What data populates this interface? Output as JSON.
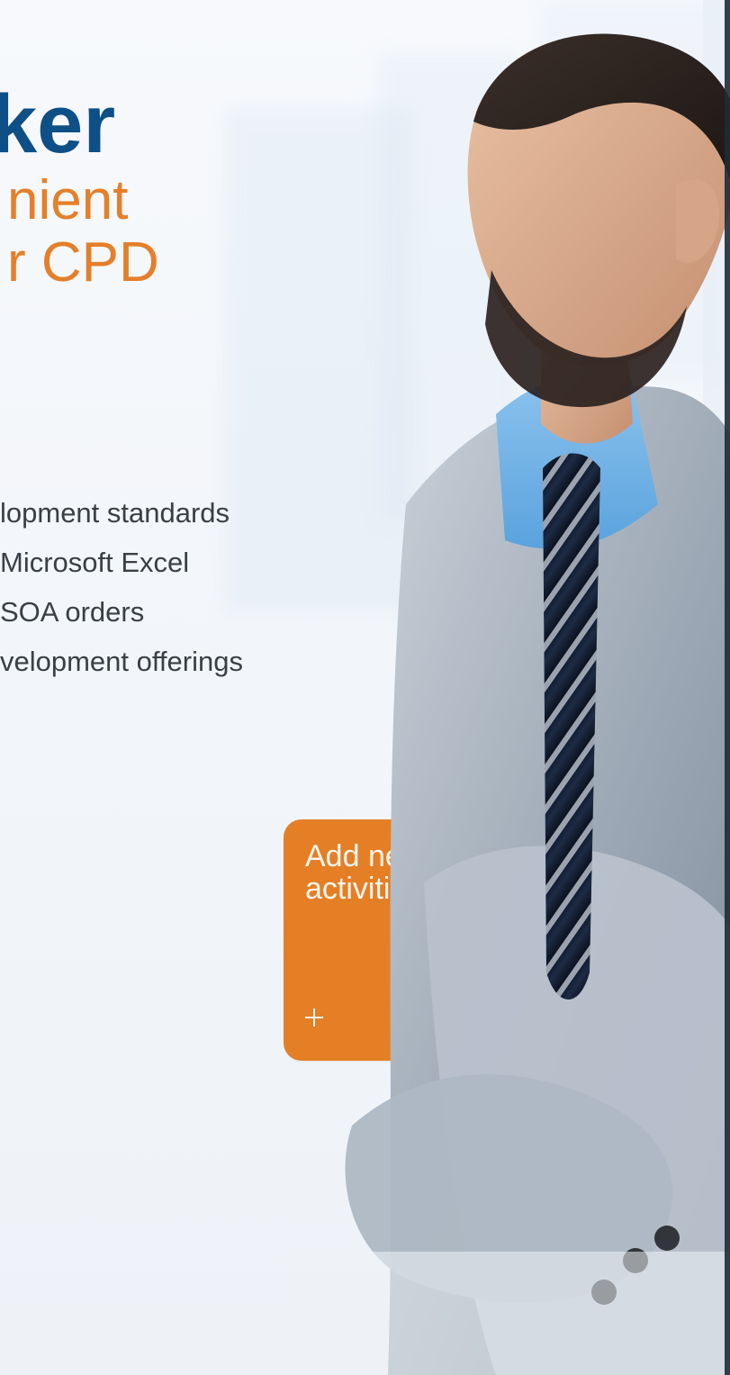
{
  "headline": {
    "main_fragment": "ker",
    "sub_lines": [
      "nient",
      "r CPD"
    ]
  },
  "list": {
    "items": [
      "lopment standards",
      "Microsoft Excel",
      "SOA orders",
      "velopment offerings"
    ]
  },
  "card": {
    "title": "Add new\nactivities",
    "plus_icon": "plus-icon"
  },
  "colors": {
    "headline_blue": "#0e4f86",
    "accent_orange": "#e57f2a",
    "card_orange": "#e47f26",
    "text_gray": "#3a3f46"
  }
}
